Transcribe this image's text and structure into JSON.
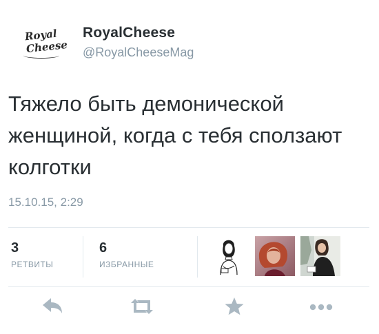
{
  "user": {
    "display_name": "RoyalCheese",
    "handle": "@RoyalCheeseMag",
    "logo_text_line1": "Royal",
    "logo_text_line2": "Cheese"
  },
  "tweet": {
    "text": "Тяжело быть демонической женщиной, когда с тебя сползают колготки",
    "timestamp": "15.10.15, 2:29"
  },
  "stats": {
    "retweets": {
      "count": "3",
      "label": "РЕТВИТЫ"
    },
    "favorites": {
      "count": "6",
      "label": "ИЗБРАННЫЕ"
    }
  },
  "favoriters": [
    {
      "icon": "sketch-woman-avatar"
    },
    {
      "icon": "woman-red-hair-avatar"
    },
    {
      "icon": "woman-black-top-avatar"
    }
  ],
  "actions": [
    {
      "icon": "reply-icon"
    },
    {
      "icon": "retweet-icon"
    },
    {
      "icon": "favorite-star-icon"
    },
    {
      "icon": "more-dots-icon"
    }
  ],
  "colors": {
    "text": "#292f33",
    "secondary": "#8899a6",
    "divider": "#e1e8ed",
    "action_icon": "#aab8c2"
  }
}
